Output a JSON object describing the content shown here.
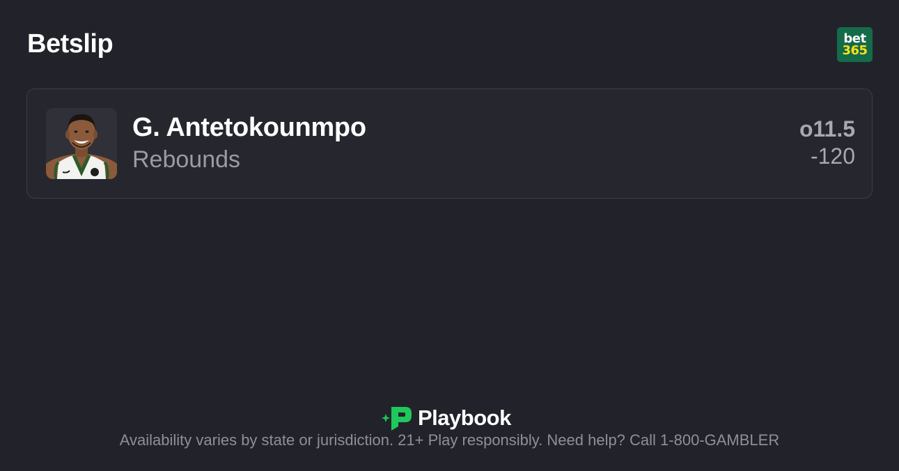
{
  "header": {
    "title": "Betslip",
    "book_logo": {
      "line1": "bet",
      "line2": "365",
      "bg_color": "#136b49",
      "accent_color": "#ffdf1b"
    }
  },
  "bet": {
    "player_name": "G. Antetokounmpo",
    "market": "Rebounds",
    "line": "o11.5",
    "odds": "-120",
    "avatar_icon": "player-headshot-icon"
  },
  "footer": {
    "brand": "Playbook",
    "brand_color": "#1ec85a",
    "disclaimer": "Availability varies by state or jurisdiction. 21+ Play responsibly. Need help? Call 1-800-GAMBLER"
  }
}
